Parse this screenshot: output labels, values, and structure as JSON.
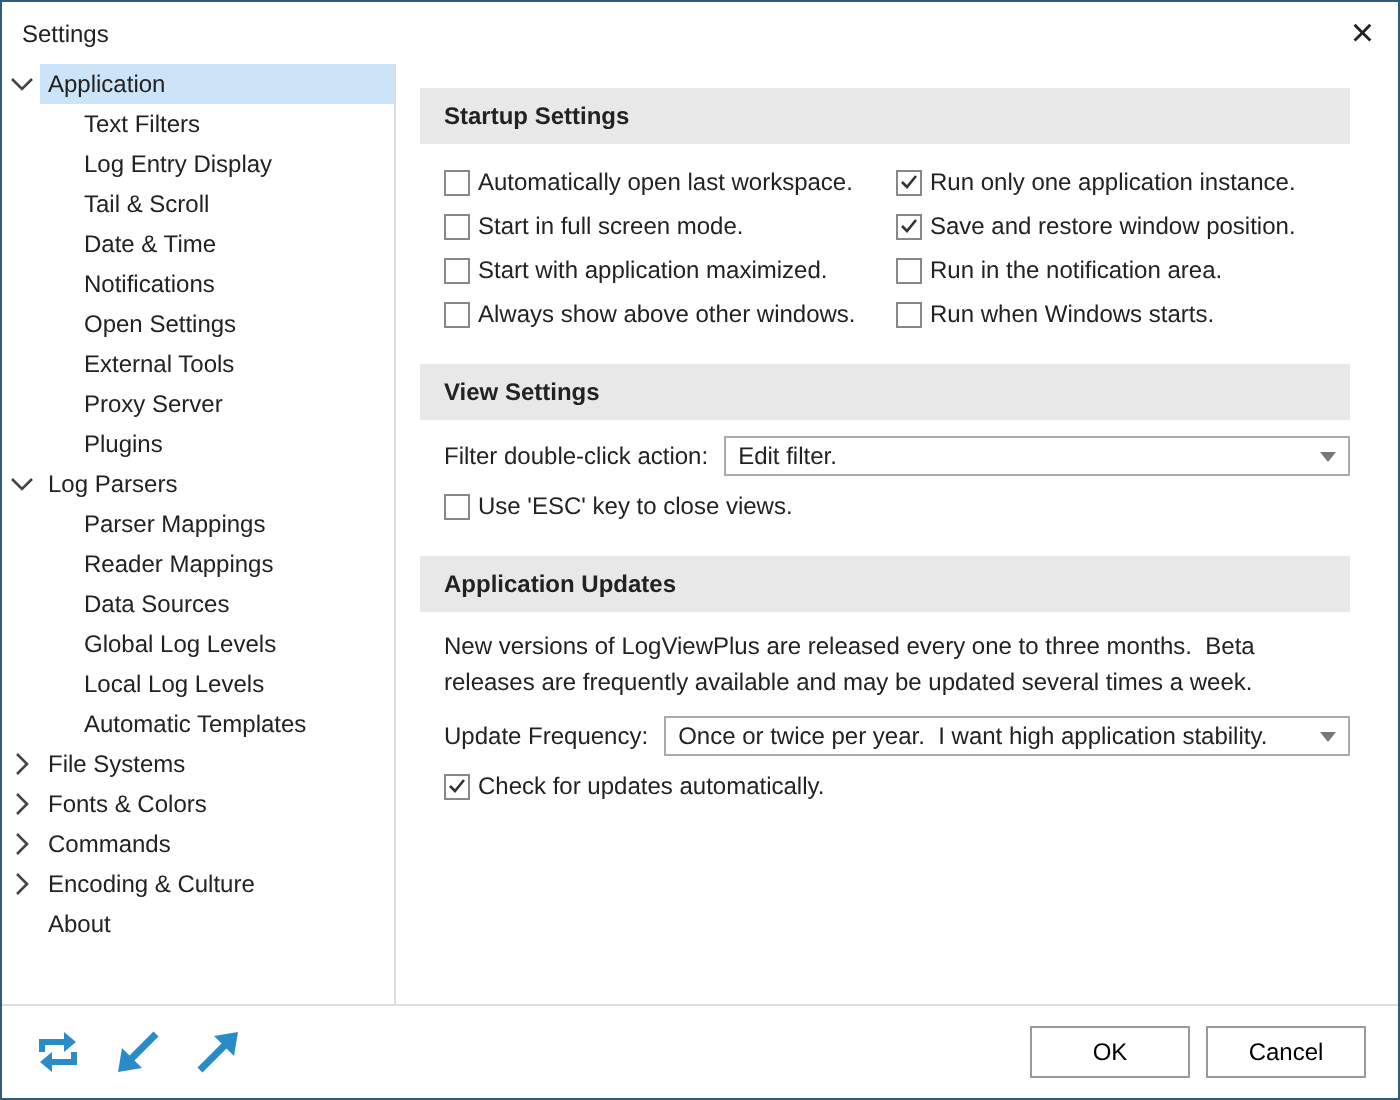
{
  "window": {
    "title": "Settings",
    "close": "×"
  },
  "tree": [
    {
      "label": "Application",
      "selected": true,
      "expanded": true,
      "children": [
        {
          "label": "Text Filters",
          "selected": false
        },
        {
          "label": "Log Entry Display",
          "selected": false
        },
        {
          "label": "Tail & Scroll",
          "selected": false
        },
        {
          "label": "Date & Time",
          "selected": false
        },
        {
          "label": "Notifications",
          "selected": false
        },
        {
          "label": "Open Settings",
          "selected": false
        },
        {
          "label": "External Tools",
          "selected": false
        },
        {
          "label": "Proxy Server",
          "selected": false
        },
        {
          "label": "Plugins",
          "selected": false
        }
      ]
    },
    {
      "label": "Log Parsers",
      "selected": false,
      "expanded": true,
      "children": [
        {
          "label": "Parser Mappings",
          "selected": false
        },
        {
          "label": "Reader Mappings",
          "selected": false
        },
        {
          "label": "Data Sources",
          "selected": false
        },
        {
          "label": "Global Log Levels",
          "selected": false
        },
        {
          "label": "Local Log Levels",
          "selected": false
        },
        {
          "label": "Automatic Templates",
          "selected": false
        }
      ]
    },
    {
      "label": "File Systems",
      "selected": false,
      "expanded": false
    },
    {
      "label": "Fonts & Colors",
      "selected": false,
      "expanded": false
    },
    {
      "label": "Commands",
      "selected": false,
      "expanded": false
    },
    {
      "label": "Encoding & Culture",
      "selected": false,
      "expanded": false
    },
    {
      "label": "About",
      "selected": false
    }
  ],
  "sections": [
    {
      "title": "Startup Settings",
      "items": [
        {
          "kind": "checkgrid",
          "columns": [
            [
              {
                "label": "Automatically open last workspace.",
                "checked": false
              },
              {
                "label": "Start in full screen mode.",
                "checked": false
              },
              {
                "label": "Start with application maximized.",
                "checked": false
              },
              {
                "label": "Always show above other windows.",
                "checked": false
              }
            ],
            [
              {
                "label": "Run only one application instance.",
                "checked": true
              },
              {
                "label": "Save and restore window position.",
                "checked": true
              },
              {
                "label": "Run in the notification area.",
                "checked": false
              },
              {
                "label": "Run when Windows starts.",
                "checked": false
              }
            ]
          ]
        }
      ]
    },
    {
      "title": "View Settings",
      "items": [
        {
          "kind": "dropdown",
          "label": "Filter double-click action:",
          "value": "Edit filter."
        },
        {
          "kind": "checkbox",
          "label": "Use 'ESC' key to close views.",
          "checked": false
        }
      ]
    },
    {
      "title": "Application Updates",
      "items": [
        {
          "kind": "text",
          "text": "New versions of LogViewPlus are released every one to three months.  Beta releases are frequently available and may be updated several times a week."
        },
        {
          "kind": "dropdown",
          "label": "Update Frequency:",
          "value": "Once or twice per year.  I want high application stability."
        },
        {
          "kind": "checkbox",
          "label": "Check for updates automatically.",
          "checked": true
        }
      ]
    }
  ],
  "footer": {
    "buttons": [
      "OK",
      "Cancel"
    ]
  }
}
